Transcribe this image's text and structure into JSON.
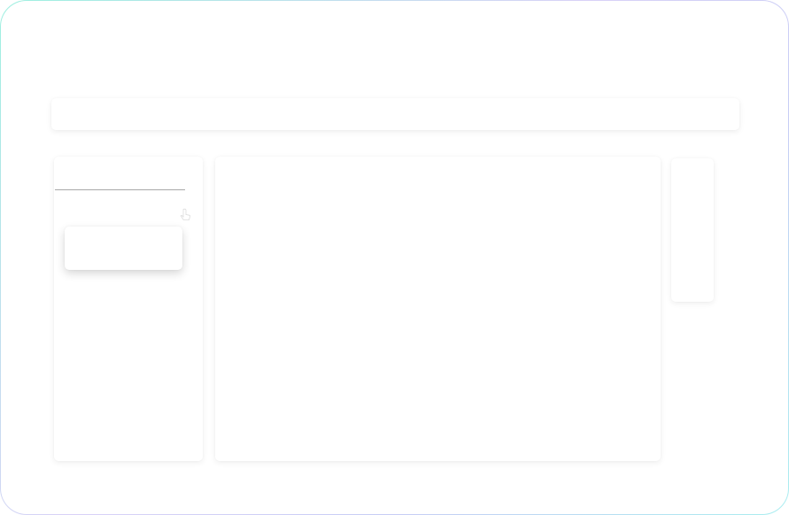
{
  "app": {
    "theme": {
      "frame_gradient": [
        "#9ef0e0",
        "#d9d2f7",
        "#c7cdf5",
        "#a9eef0"
      ],
      "card_background": "#ffffff",
      "divider_color": "#a8a8a8"
    }
  },
  "topbar": {},
  "left_panel": {
    "cursor_icon": "hand-pointer-icon",
    "floating_card": {}
  },
  "main_panel": {},
  "right_panel": {}
}
